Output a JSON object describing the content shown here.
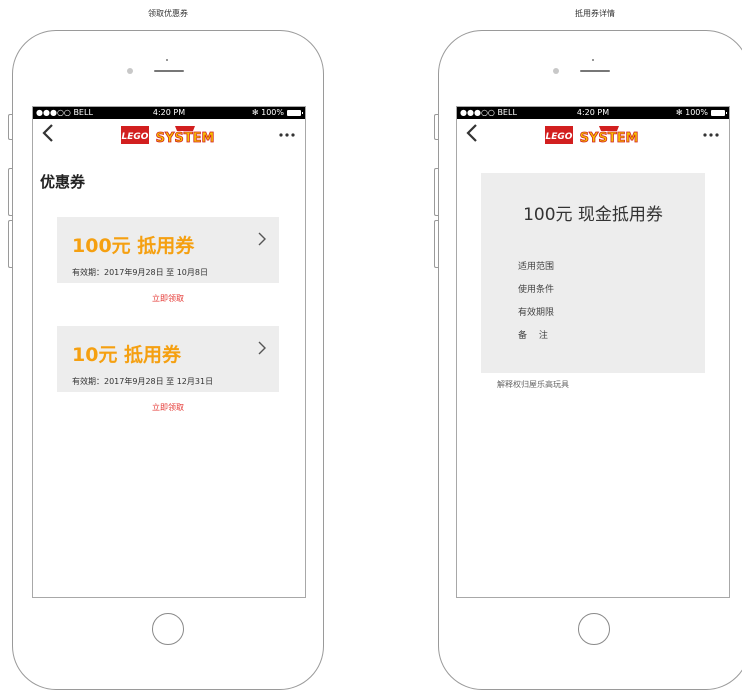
{
  "left_screen": {
    "caption": "领取优惠券",
    "status": {
      "carrier": "●●●○○ BELL",
      "time": "4:20 PM",
      "battery": "✻ 100%"
    },
    "logo": {
      "lego": "LEGO",
      "system": "SYSTEM"
    },
    "title": "优惠券",
    "coupons": [
      {
        "title": "100元 抵用券",
        "validity": "有效期：2017年9月28日 至 10月8日",
        "claim": "立即领取"
      },
      {
        "title": "10元 抵用券",
        "validity": "有效期：2017年9月28日 至 12月31日",
        "claim": "立即领取"
      }
    ]
  },
  "right_screen": {
    "caption": "抵用券详情",
    "status": {
      "carrier": "●●●○○ BELL",
      "time": "4:20 PM",
      "battery": "✻ 100%"
    },
    "logo": {
      "lego": "LEGO",
      "system": "SYSTEM"
    },
    "detail": {
      "title": "100元 现金抵用券",
      "labels": [
        "适用范围",
        "使用条件",
        "有效期限",
        "备　 注"
      ]
    },
    "footnote": "解释权归屋乐高玩具"
  },
  "colors": {
    "coupon_title": "#f5a011",
    "claim_link": "#e53935",
    "card_bg": "#ededed",
    "logo_red": "#d21f1f",
    "logo_yellow": "#f6c300"
  }
}
